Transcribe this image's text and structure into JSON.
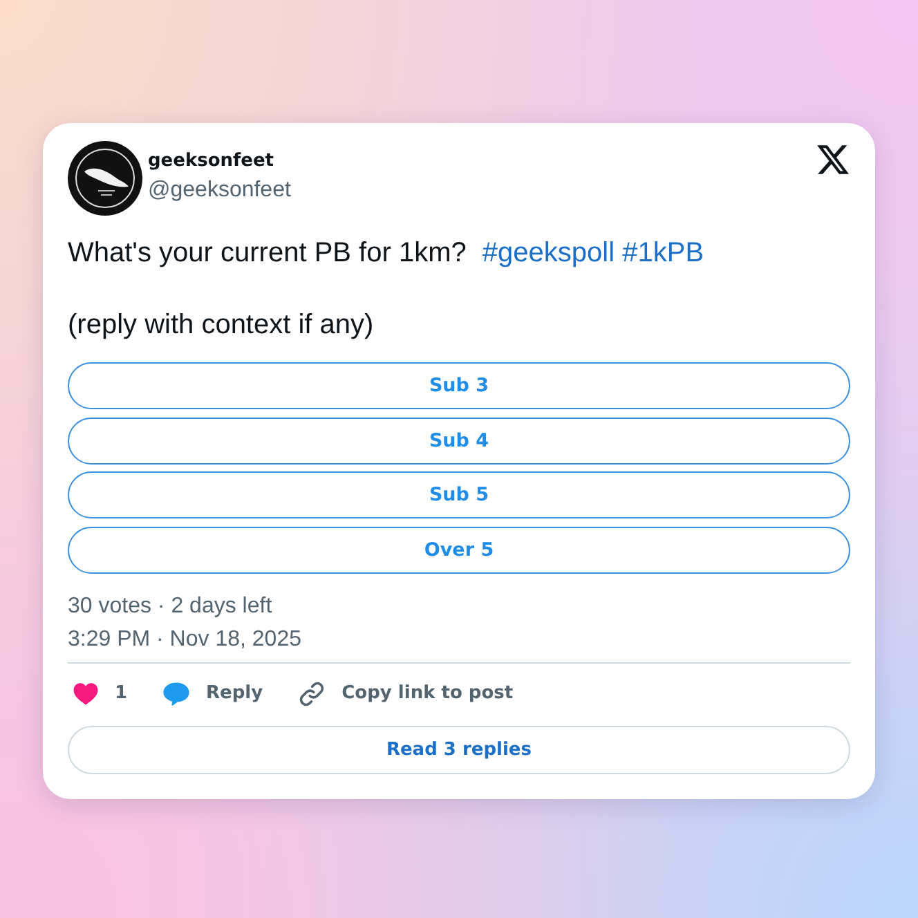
{
  "post": {
    "author": {
      "name": "geeksonfeet",
      "handle": "@geeksonfeet"
    },
    "text": {
      "body": "What's your current PB for 1km?",
      "hashtags": [
        "#geekspoll",
        "#1kPB"
      ],
      "note": "(reply with context if any)"
    },
    "poll": {
      "options": [
        {
          "label": "Sub 3"
        },
        {
          "label": "Sub 4"
        },
        {
          "label": "Sub 5"
        },
        {
          "label": "Over 5"
        }
      ],
      "summary": "30 votes · 2 days left"
    },
    "timestamp": "3:29 PM · Nov 18, 2025",
    "actions": [
      {
        "kind": "like",
        "label": "1"
      },
      {
        "kind": "reply",
        "label": "Reply"
      },
      {
        "kind": "copy_link",
        "label": "Copy link to post"
      }
    ],
    "read_replies": "Read 3 replies"
  }
}
